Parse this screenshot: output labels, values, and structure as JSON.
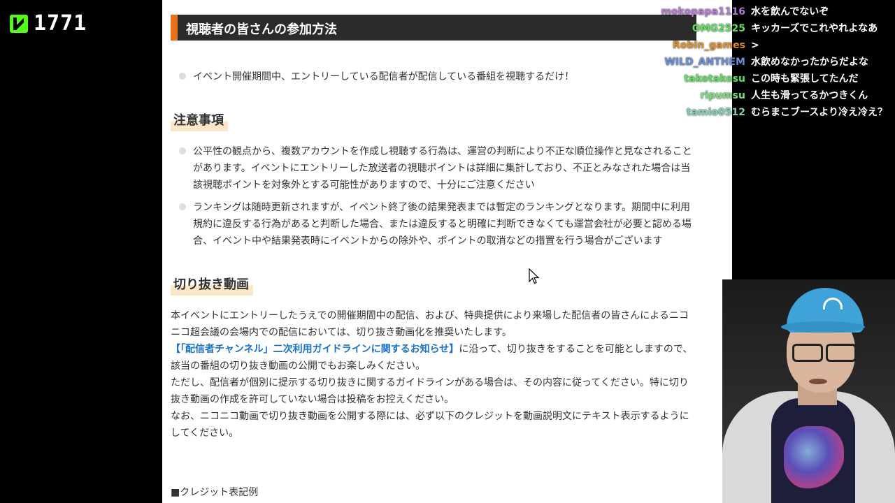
{
  "stream": {
    "viewer_count": "1771",
    "logo_icon": "kick-logo-icon",
    "brand_color": "#53fc18"
  },
  "doc": {
    "section_title": "視聴者の皆さんの参加方法",
    "participation_bullet": "イベント開催期間中、エントリーしている配信者が配信している番組を視聴するだけ！",
    "notes_heading": "注意事項",
    "notes": [
      "公平性の観点から、複数アカウントを作成し視聴する行為は、運営の判断により不正な順位操作と見なされることがあります。イベントにエントリーした放送者の視聴ポイントは詳細に集計しており、不正とみなされた場合は当該視聴ポイントを対象外とする可能性がありますので、十分にご注意ください",
      "ランキングは随時更新されますが、イベント終了後の結果発表までは暫定のランキングとなります。期間中に利用規約に違反する行為があると判断した場合、または違反すると明確に判断できなくても運営会社が必要と認める場合、イベント中や結果発表時にイベントからの除外や、ポイントの取消などの措置を行う場合がございます"
    ],
    "clip_heading": "切り抜き動画",
    "clip_para1": "本イベントにエントリーしたうえでの開催期間中の配信、および、特典提供により来場した配信者の皆さんによるニコニコ超会議の会場内での配信においては、切り抜き動画化を推奨いたします。",
    "clip_link": "【「配信者チャンネル」二次利用ガイドラインに関するお知らせ】",
    "clip_para2_rest": "に沿って、切り抜きをすることを可能としますので、該当の番組の切り抜き動画の公開でもお楽しみください。",
    "clip_para3": "ただし、配信者が個別に提示する切り抜きに関するガイドラインがある場合は、その内容に従ってください。特に切り抜き動画の作成を許可していない場合は投稿をお控えください。",
    "clip_para4": "なお、ニコニコ動画で切り抜き動画を公開する際には、必ず以下のクレジットを動画説明文にテキスト表示するようにしてください。",
    "credit_label": "■クレジット表記例",
    "accent_color": "#e8701a",
    "link_color": "#1a73c9"
  },
  "chat": [
    {
      "user": "mokopapa1116",
      "color": "#b57ad6",
      "message": "水を飲んでないぞ"
    },
    {
      "user": "OMG2525",
      "color": "#5fe05f",
      "message": "キッカーズでこれやれよなあ"
    },
    {
      "user": "Robin_games",
      "color": "#e0902a",
      "message": ">"
    },
    {
      "user": "WILD_ANTHEM",
      "color": "#6a8fd6",
      "message": "水飲めなかったからだよな"
    },
    {
      "user": "takotakosu",
      "color": "#5fe05f",
      "message": "この時も緊張してたんだ"
    },
    {
      "user": "ripumsu",
      "color": "#7be07b",
      "message": "人生も滑ってるかつきくん"
    },
    {
      "user": "tamio0512",
      "color": "#7fd0c0",
      "message": "むらまこブースより冷え冷え？"
    }
  ]
}
